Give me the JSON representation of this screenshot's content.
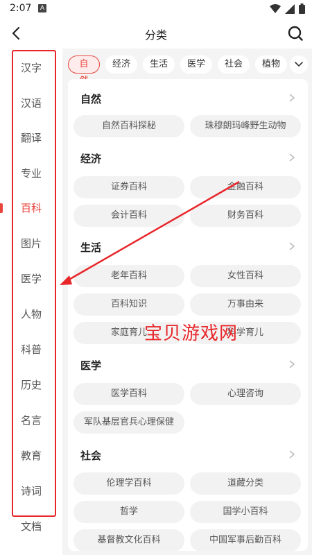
{
  "status_bar": {
    "time": "2:07",
    "notif_letter": "A"
  },
  "header": {
    "title": "分类",
    "back_icon": "arrow-left-icon",
    "search_icon": "search-icon"
  },
  "sidebar": {
    "active_index": 4,
    "items": [
      {
        "label": "汉字"
      },
      {
        "label": "汉语"
      },
      {
        "label": "翻译"
      },
      {
        "label": "专业"
      },
      {
        "label": "百科"
      },
      {
        "label": "图片"
      },
      {
        "label": "医学"
      },
      {
        "label": "人物"
      },
      {
        "label": "科普"
      },
      {
        "label": "历史"
      },
      {
        "label": "名言"
      },
      {
        "label": "教育"
      },
      {
        "label": "诗词"
      },
      {
        "label": "文档"
      }
    ]
  },
  "chips": [
    {
      "label": "自然",
      "active": true
    },
    {
      "label": "经济"
    },
    {
      "label": "生活"
    },
    {
      "label": "医学"
    },
    {
      "label": "社会"
    },
    {
      "label": "植物"
    }
  ],
  "sections": [
    {
      "title": "自然",
      "tags": [
        "自然百科探秘",
        "珠穆朗玛峰野生动物"
      ]
    },
    {
      "title": "经济",
      "tags": [
        "证券百科",
        "金融百科",
        "会计百科",
        "财务百科"
      ]
    },
    {
      "title": "生活",
      "tags": [
        "老年百科",
        "女性百科",
        "百科知识",
        "万事由来",
        "家庭育儿",
        "科学育儿"
      ]
    },
    {
      "title": "医学",
      "tags": [
        "医学百科",
        "心理咨询",
        "军队基层官兵心理保健"
      ]
    },
    {
      "title": "社会",
      "tags": [
        "伦理学百科",
        "道藏分类",
        "哲学",
        "国学小百科",
        "基督教文化百科",
        "中国军事后勤百科"
      ]
    }
  ],
  "watermark": "宝贝游戏网",
  "colors": {
    "accent": "#e8453c",
    "annotation": "#e8262a"
  }
}
